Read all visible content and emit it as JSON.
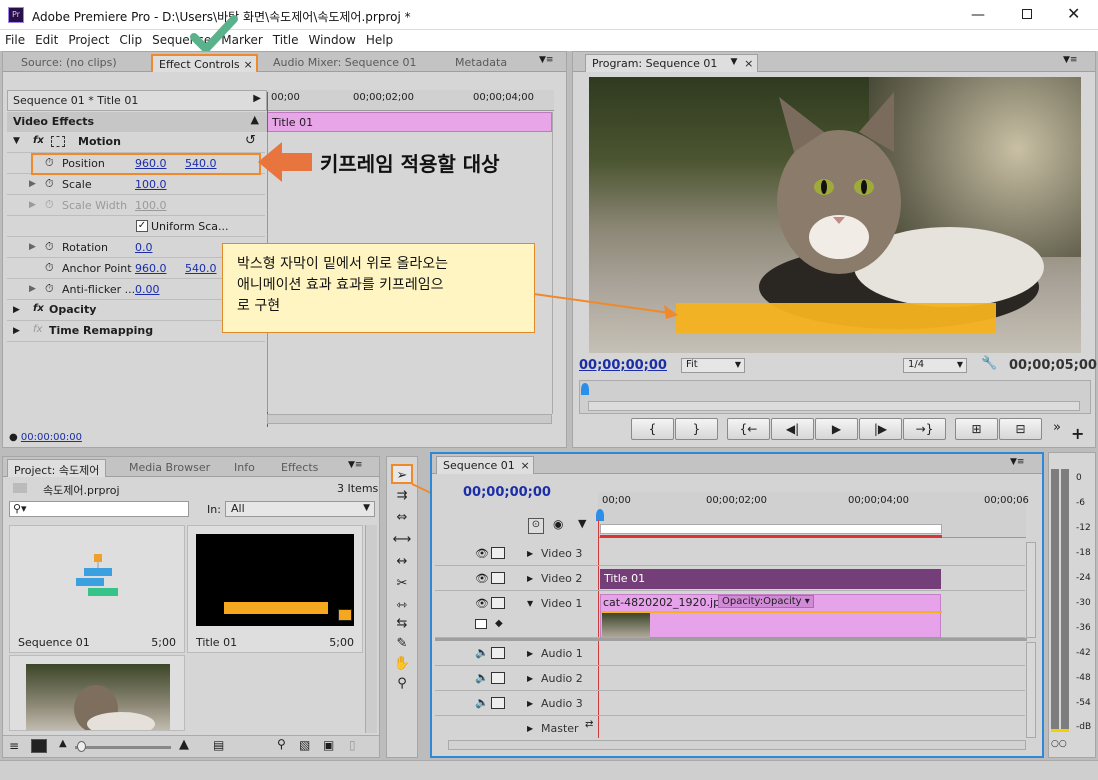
{
  "app": {
    "title": "Adobe Premiere Pro - D:\\Users\\바탕 화면\\속도제어\\속도제어.prproj *",
    "logo": "Pr"
  },
  "menu": [
    "File",
    "Edit",
    "Project",
    "Clip",
    "Sequence",
    "Marker",
    "Title",
    "Window",
    "Help"
  ],
  "top_left_tabs": [
    "Source: (no clips)",
    "Effect Controls",
    "Audio Mixer: Sequence 01",
    "Metadata"
  ],
  "effect_controls": {
    "sequence_label": "Sequence 01 * Title 01",
    "times": [
      "00;00",
      "00;00;02;00",
      "00;00;04;00"
    ],
    "clip_label": "Title 01",
    "video_effects": "Video Effects",
    "motion": "Motion",
    "rows": [
      {
        "name": "Position",
        "v1": "960.0",
        "v2": "540.0"
      },
      {
        "name": "Scale",
        "v1": "100.0",
        "v2": ""
      },
      {
        "name": "Scale Width",
        "v1": "100.0",
        "v2": ""
      },
      {
        "name": "Uniform Sca...",
        "v1": "",
        "v2": ""
      },
      {
        "name": "Rotation",
        "v1": "0.0",
        "v2": ""
      },
      {
        "name": "Anchor Point",
        "v1": "960.0",
        "v2": "540.0"
      },
      {
        "name": "Anti-flicker ...",
        "v1": "0.00",
        "v2": ""
      }
    ],
    "opacity": "Opacity",
    "time_remap": "Time Remapping",
    "timecode": "00:00:00:00"
  },
  "annotation": {
    "keyframe_target": "키프레임 적용할 대상",
    "callout": [
      "박스형 자막이 밑에서 위로 올라오는",
      "애니메이션 효과  효과를 키프레임으",
      "로 구현"
    ]
  },
  "program": {
    "tab": "Program: Sequence 01",
    "timecode_left": "00;00;00;00",
    "fit": "Fit",
    "resolution": "1/4",
    "timecode_right": "00;00;05;00",
    "overlay_color": "#f5b21f"
  },
  "transport": [
    "{",
    "}",
    "{←",
    "◀|",
    "▶",
    "|▶",
    "→}",
    "⊞",
    "⊟"
  ],
  "project": {
    "tabs": [
      "Project: 속도제어",
      "Media Browser",
      "Info",
      "Effects"
    ],
    "file": "속도제어.prproj",
    "count": "3 Items",
    "in_label": "In:",
    "in_value": "All",
    "items": [
      {
        "name": "Sequence 01",
        "dur": "5;00"
      },
      {
        "name": "Title 01",
        "dur": "5;00"
      }
    ]
  },
  "sequence": {
    "tab": "Sequence 01",
    "timecode": "00;00;00;00",
    "ruler": [
      "00;00",
      "00;00;02;00",
      "00;00;04;00",
      "00;00;06"
    ],
    "tracks": [
      "Video 3",
      "Video 2",
      "Video 1",
      "Audio 1",
      "Audio 2",
      "Audio 3",
      "Master"
    ],
    "clip_title": "Title 01",
    "clip_image": "cat-4820202_1920.jpg",
    "clip_opacity": "Opacity:Opacity"
  },
  "meter": [
    "0",
    "-6",
    "-12",
    "-18",
    "-24",
    "-30",
    "-36",
    "-42",
    "-48",
    "-54",
    "-dB"
  ]
}
